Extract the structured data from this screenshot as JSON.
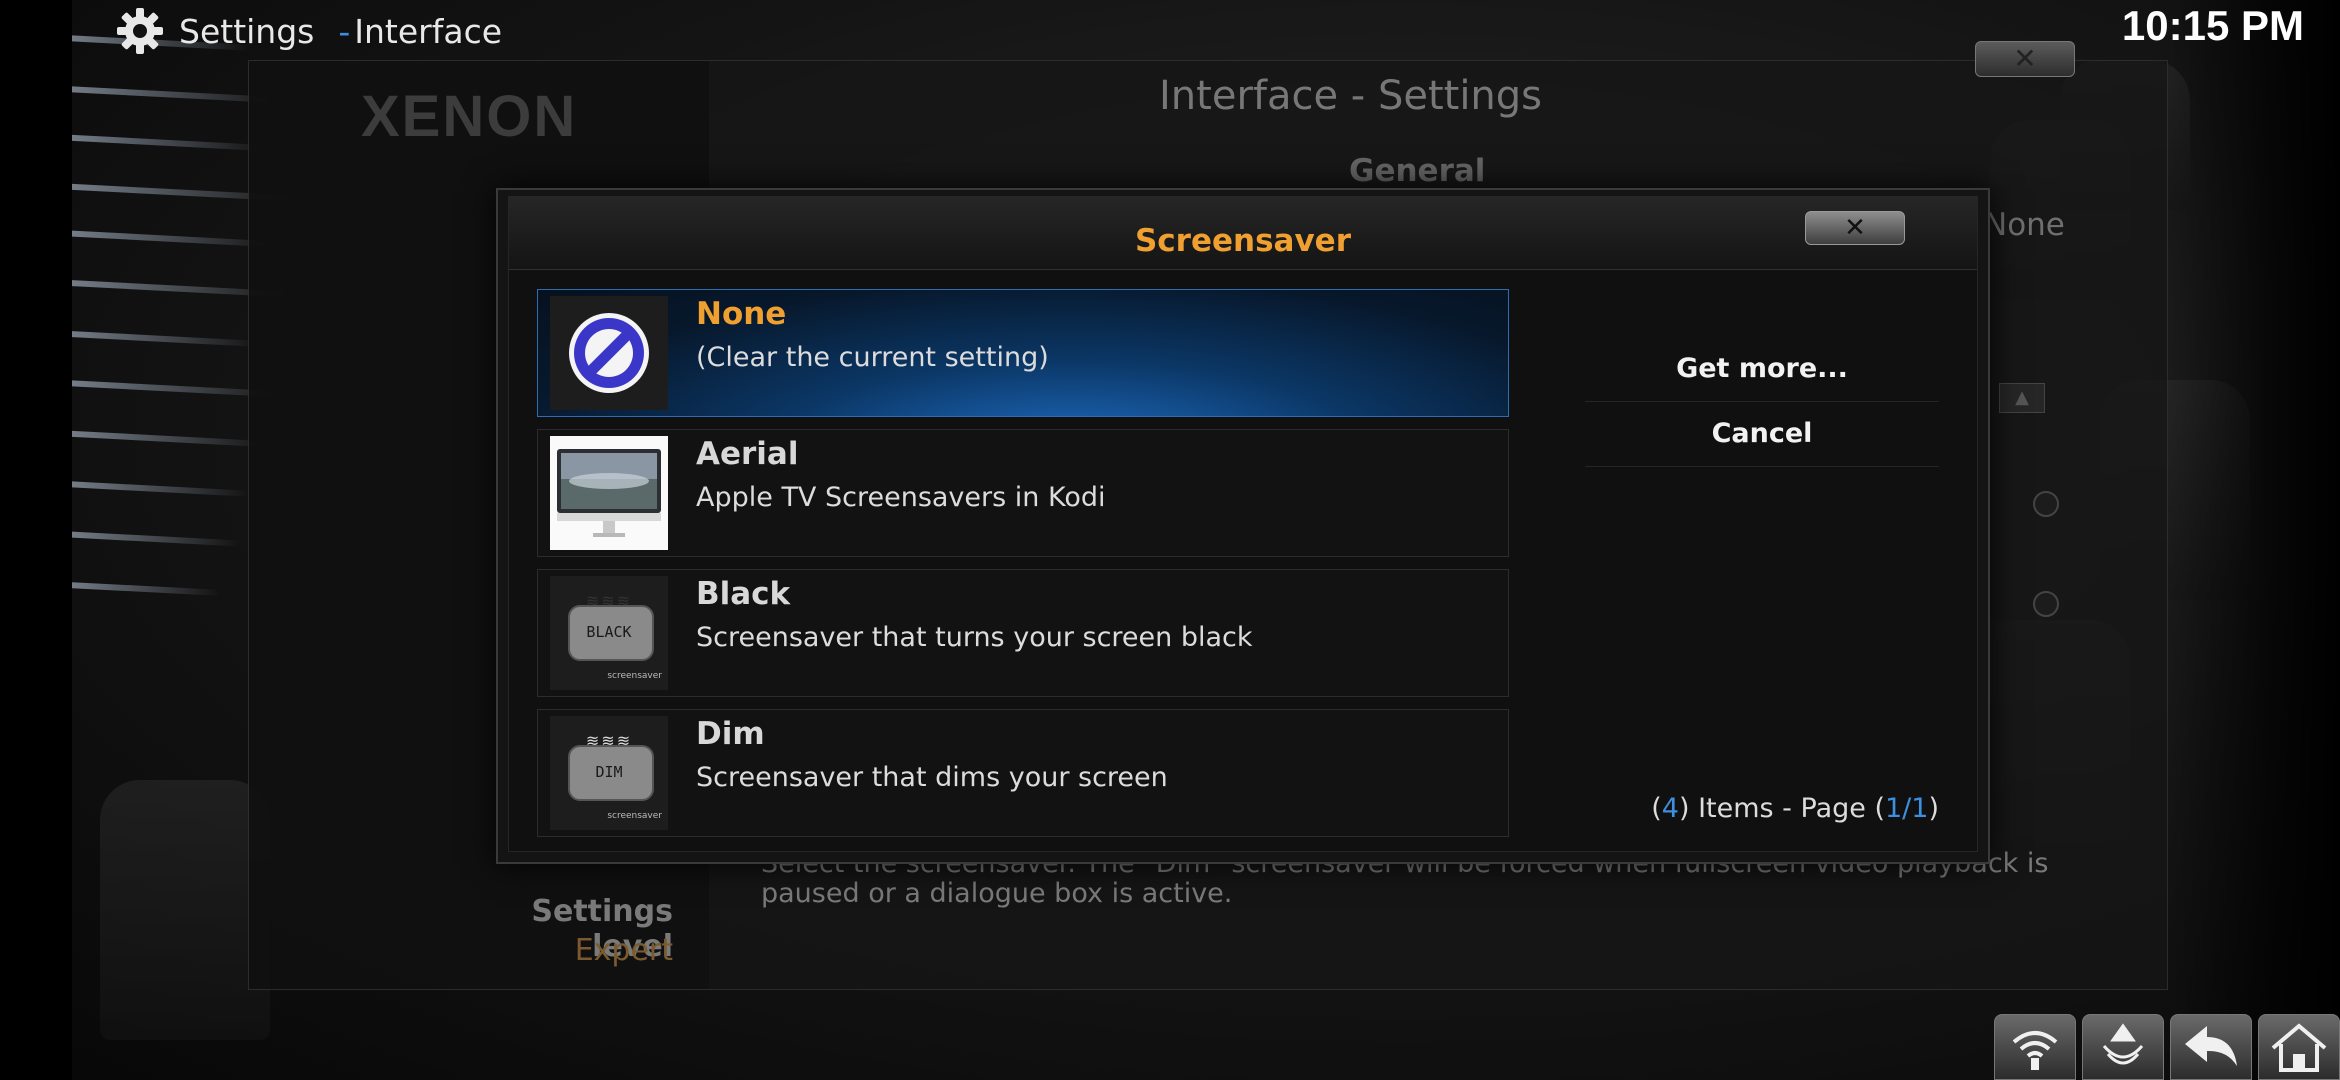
{
  "topbar": {
    "title": "Settings",
    "separator": "-",
    "subtitle": "Interface",
    "clock": "10:15 PM",
    "icon": "gear-icon"
  },
  "settings_panel": {
    "logo": "XENON",
    "heading": "Interface - Settings",
    "section": "General",
    "current_value": "None",
    "description": "Select the screensaver. The \"Dim\" screensaver will be forced when fullscreen video playback is paused or a dialogue box is active.",
    "settings_level_label": "Settings level",
    "settings_level_value": "Expert",
    "close_label": "✕"
  },
  "dialog": {
    "title": "Screensaver",
    "close_label": "✕",
    "items": [
      {
        "title": "None",
        "desc": "(Clear the current setting)",
        "icon": "no-entry-icon",
        "selected": true
      },
      {
        "title": "Aerial",
        "desc": "Apple TV Screensavers in Kodi",
        "icon": "monitor-thumbnail",
        "selected": false
      },
      {
        "title": "Black",
        "desc": "Screensaver that turns your screen black",
        "icon": "black-addon-icon",
        "selected": false
      },
      {
        "title": "Dim",
        "desc": "Screensaver that dims your screen",
        "icon": "dim-addon-icon",
        "selected": false
      }
    ],
    "buttons": {
      "get_more": "Get more...",
      "cancel": "Cancel"
    },
    "count": {
      "open_paren": "(",
      "items": "4",
      "mid": ") Items - Page (",
      "page": "1/1",
      "close_paren": ")"
    },
    "thumb_labels": {
      "black": "BLACK",
      "dim": "DIM",
      "caption": "screensaver"
    }
  },
  "nav": {
    "icons": [
      "network-icon",
      "eject-icon",
      "back-icon",
      "home-icon"
    ]
  },
  "colors": {
    "accent_orange": "#f0a030",
    "accent_blue": "#3d8fe0"
  }
}
